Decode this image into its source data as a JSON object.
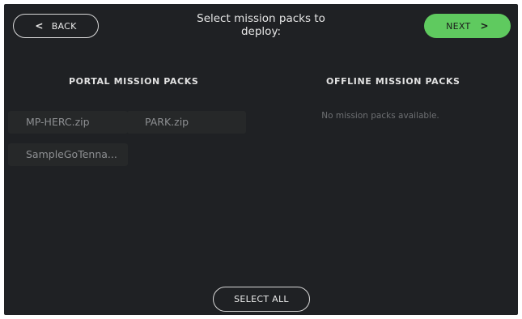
{
  "header": {
    "back_icon": "chevron-left-icon",
    "back_glyph": "<",
    "back_label": "BACK",
    "title_line1": "Select mission packs to",
    "title_line2": "deploy:",
    "next_label": "NEXT",
    "next_icon": "chevron-right-icon",
    "next_glyph": ">"
  },
  "portal": {
    "header": "PORTAL MISSION PACKS",
    "items": [
      {
        "label": "MP-HERC.zip"
      },
      {
        "label": "PARK.zip"
      },
      {
        "label": "SampleGoTenna..."
      }
    ]
  },
  "offline": {
    "header": "OFFLINE MISSION PACKS",
    "empty_message": "No mission packs available."
  },
  "footer": {
    "select_all_label": "SELECT ALL"
  },
  "colors": {
    "background": "#1f2124",
    "accent_green": "#5fca5f",
    "item_background": "#262829",
    "outline": "#d8d8d8"
  }
}
